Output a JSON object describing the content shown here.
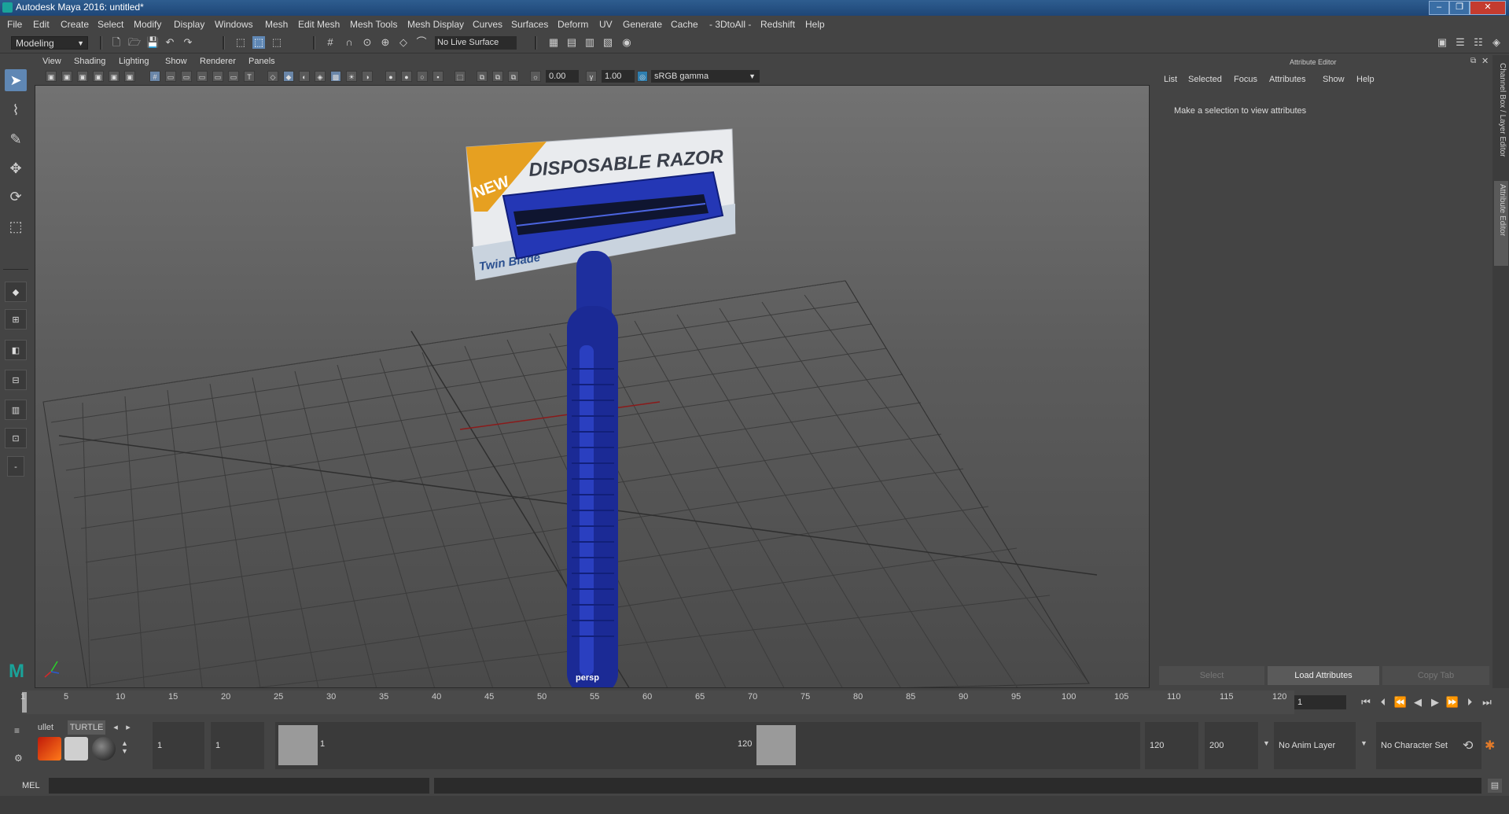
{
  "window": {
    "title": "Autodesk Maya 2016: untitled*"
  },
  "menus": [
    "File",
    "Edit",
    "Create",
    "Select",
    "Modify",
    "Display",
    "Windows",
    "Mesh",
    "Edit Mesh",
    "Mesh Tools",
    "Mesh Display",
    "Curves",
    "Surfaces",
    "Deform",
    "UV",
    "Generate",
    "Cache",
    "- 3DtoAll -",
    "Redshift",
    "Help"
  ],
  "status_line": {
    "mode": "Modeling",
    "live_surface": "No Live Surface"
  },
  "viewport": {
    "menus": [
      "View",
      "Shading",
      "Lighting",
      "Show",
      "Renderer",
      "Panels"
    ],
    "exposure": "0.00",
    "gamma": "1.00",
    "color_space": "sRGB gamma",
    "camera_label": "persp",
    "model": {
      "package_text_main": "DISPOSABLE RAZOR",
      "package_text_corner": "NEW",
      "package_text_sub": "Twin Blade"
    }
  },
  "attribute_editor": {
    "title": "Attribute Editor",
    "menus": [
      "List",
      "Selected",
      "Focus",
      "Attributes",
      "Show",
      "Help"
    ],
    "message": "Make a selection to view attributes",
    "buttons": {
      "select": "Select",
      "load": "Load Attributes",
      "copy": "Copy Tab"
    },
    "side_tabs": [
      "Channel Box / Layer Editor",
      "Attribute Editor"
    ]
  },
  "time_slider": {
    "ticks": [
      "1",
      "5",
      "10",
      "15",
      "20",
      "25",
      "30",
      "35",
      "40",
      "45",
      "50",
      "55",
      "60",
      "65",
      "70",
      "75",
      "80",
      "85",
      "90",
      "95",
      "100",
      "105",
      "110",
      "115",
      "120"
    ],
    "current_frame": "1"
  },
  "range_slider": {
    "shelf_tabs": [
      "ullet",
      "TURTLE"
    ],
    "start": "1",
    "playback_start": "1",
    "handle_start": "1",
    "handle_end": "120",
    "playback_end": "120",
    "end": "200",
    "anim_layer": "No Anim Layer",
    "character_set": "No Character Set"
  },
  "command_line": {
    "label": "MEL"
  }
}
